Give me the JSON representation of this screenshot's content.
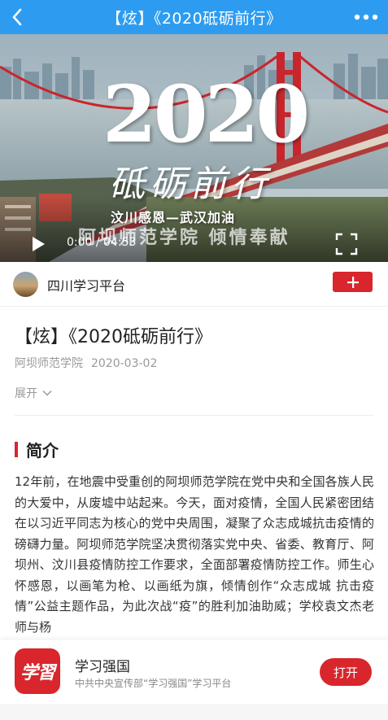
{
  "header": {
    "title": "【炫】《2020砥砺前行》",
    "back_icon": "chevron-left-icon",
    "more_icon": "more-dots-icon"
  },
  "video": {
    "overlay_title": "2020",
    "overlay_calligraphy": "砥砺前行",
    "overlay_subtitle": "汶川感恩—武汉加油",
    "watermark": "阿坝师范学院 倾情奉献",
    "time": "0:00 / 04:53",
    "play_icon": "play-icon",
    "fullscreen_icon": "fullscreen-icon"
  },
  "channel": {
    "name": "四川学习平台",
    "follow_icon": "plus-icon"
  },
  "article": {
    "title": "【炫】《2020砥砺前行》",
    "source": "阿坝师范学院",
    "date": "2020-03-02",
    "expand_label": "展开",
    "intro_heading": "简介",
    "intro_text": "12年前，在地震中受重创的阿坝师范学院在党中央和全国各族人民的大爱中，从废墟中站起来。今天，面对疫情，全国人民紧密团结在以习近平同志为核心的党中央周围，凝聚了众志成城抗击疫情的磅礴力量。阿坝师范学院坚决贯彻落实党中央、省委、教育厅、阿坝州、汶川县疫情防控工作要求，全面部署疫情防控工作。师生心怀感恩，以画笔为枪、以画纸为旗，倾情创作“众志成城 抗击疫情”公益主题作品，为此次战“疫”的胜利加油助威；学校袁文杰老师与杨"
  },
  "app_banner": {
    "logo_text": "学習",
    "app_name": "学习强国",
    "app_desc": "中共中央宣传部“学习强国”学习平台",
    "open_label": "打开"
  },
  "colors": {
    "header_blue": "#2d9cf0",
    "accent_red": "#d8262c"
  }
}
